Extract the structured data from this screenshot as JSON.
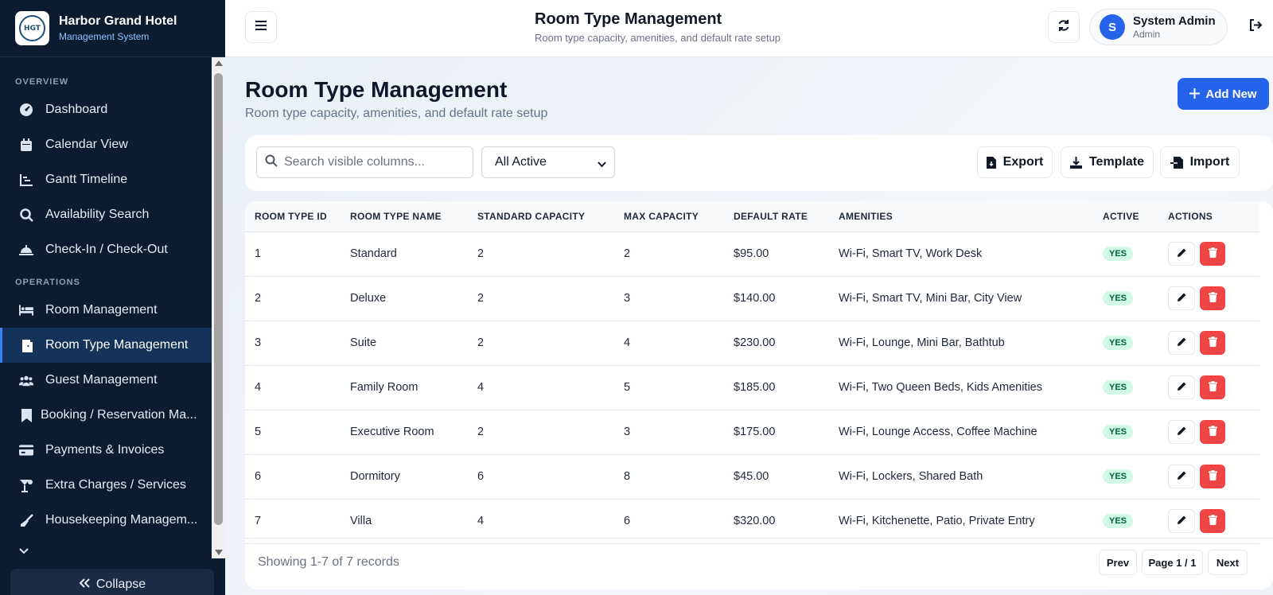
{
  "brand": {
    "name": "Harbor Grand Hotel",
    "subtitle": "Management System",
    "logo_text": "HGT"
  },
  "sidebar": {
    "sections": [
      {
        "label": "OVERVIEW",
        "items": [
          {
            "label": "Dashboard",
            "icon": "dashboard-icon"
          },
          {
            "label": "Calendar View",
            "icon": "calendar-icon"
          },
          {
            "label": "Gantt Timeline",
            "icon": "chart-icon"
          },
          {
            "label": "Availability Search",
            "icon": "search-icon"
          },
          {
            "label": "Check-In / Check-Out",
            "icon": "bell-icon"
          }
        ]
      },
      {
        "label": "OPERATIONS",
        "items": [
          {
            "label": "Room Management",
            "icon": "bed-icon"
          },
          {
            "label": "Room Type Management",
            "icon": "door-icon",
            "active": true
          },
          {
            "label": "Guest Management",
            "icon": "users-icon"
          },
          {
            "label": "Booking / Reservation Ma...",
            "icon": "bookmark-icon"
          },
          {
            "label": "Payments & Invoices",
            "icon": "card-icon"
          },
          {
            "label": "Extra Charges / Services",
            "icon": "cocktail-icon"
          },
          {
            "label": "Housekeeping Managem...",
            "icon": "broom-icon"
          }
        ]
      }
    ],
    "collapse_label": "Collapse"
  },
  "header": {
    "title": "Room Type Management",
    "subtitle": "Room type capacity, amenities, and default rate setup",
    "user": {
      "initial": "S",
      "name": "System Admin",
      "role": "Admin"
    }
  },
  "page": {
    "title": "Room Type Management",
    "subtitle": "Room type capacity, amenities, and default rate setup",
    "add_label": "Add New"
  },
  "toolbar": {
    "search_placeholder": "Search visible columns...",
    "filter_value": "All Active",
    "export_label": "Export",
    "template_label": "Template",
    "import_label": "Import"
  },
  "table": {
    "columns": [
      "ROOM TYPE ID",
      "ROOM TYPE NAME",
      "STANDARD CAPACITY",
      "MAX CAPACITY",
      "DEFAULT RATE",
      "AMENITIES",
      "ACTIVE",
      "ACTIONS"
    ],
    "rows": [
      {
        "id": "1",
        "name": "Standard",
        "std": "2",
        "max": "2",
        "rate": "$95.00",
        "amenities": "Wi-Fi, Smart TV, Work Desk",
        "active": "YES"
      },
      {
        "id": "2",
        "name": "Deluxe",
        "std": "2",
        "max": "3",
        "rate": "$140.00",
        "amenities": "Wi-Fi, Smart TV, Mini Bar, City View",
        "active": "YES"
      },
      {
        "id": "3",
        "name": "Suite",
        "std": "2",
        "max": "4",
        "rate": "$230.00",
        "amenities": "Wi-Fi, Lounge, Mini Bar, Bathtub",
        "active": "YES"
      },
      {
        "id": "4",
        "name": "Family Room",
        "std": "4",
        "max": "5",
        "rate": "$185.00",
        "amenities": "Wi-Fi, Two Queen Beds, Kids Amenities",
        "active": "YES"
      },
      {
        "id": "5",
        "name": "Executive Room",
        "std": "2",
        "max": "3",
        "rate": "$175.00",
        "amenities": "Wi-Fi, Lounge Access, Coffee Machine",
        "active": "YES"
      },
      {
        "id": "6",
        "name": "Dormitory",
        "std": "6",
        "max": "8",
        "rate": "$45.00",
        "amenities": "Wi-Fi, Lockers, Shared Bath",
        "active": "YES"
      },
      {
        "id": "7",
        "name": "Villa",
        "std": "4",
        "max": "6",
        "rate": "$320.00",
        "amenities": "Wi-Fi, Kitchenette, Patio, Private Entry",
        "active": "YES"
      }
    ]
  },
  "footer": {
    "records": "Showing 1-7 of 7 records",
    "prev": "Prev",
    "page": "Page 1 / 1",
    "next": "Next"
  },
  "colors": {
    "sidebar": "#0b1b30",
    "accent": "#2563eb",
    "danger": "#ef4444",
    "badge": "#d1fae5"
  }
}
